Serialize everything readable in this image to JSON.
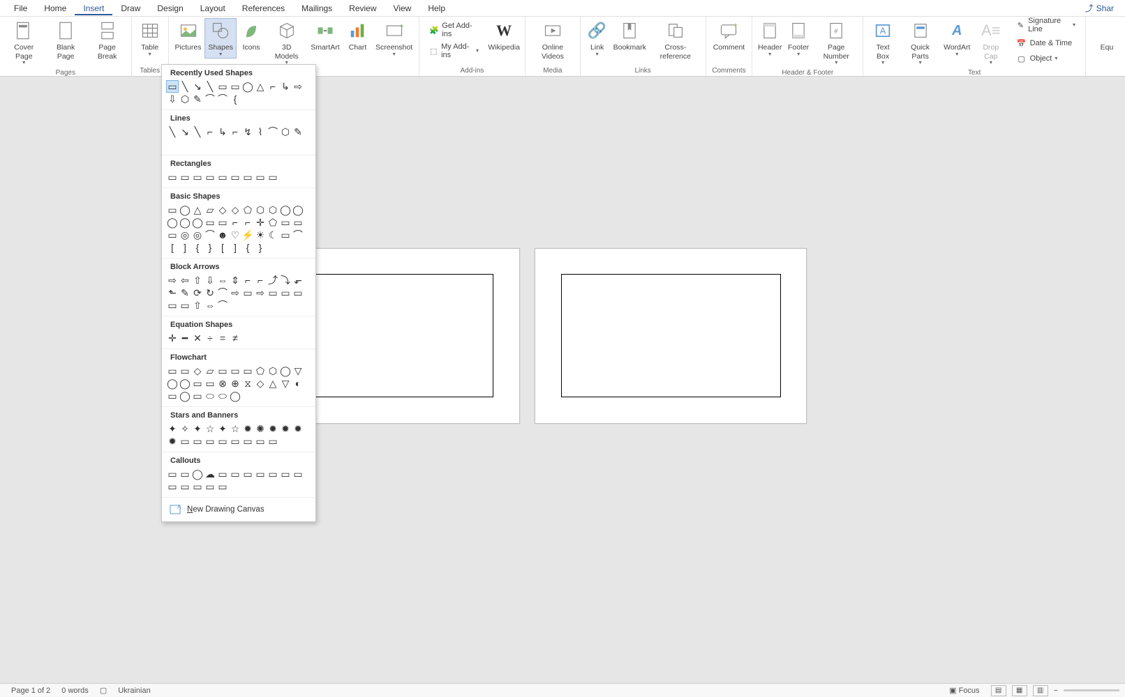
{
  "menu": {
    "tabs": [
      "File",
      "Home",
      "Insert",
      "Draw",
      "Design",
      "Layout",
      "References",
      "Mailings",
      "Review",
      "View",
      "Help"
    ],
    "active": "Insert",
    "share": "Shar"
  },
  "ribbon": {
    "groups": {
      "pages": {
        "label": "Pages",
        "items": [
          "Cover Page",
          "Blank Page",
          "Page Break"
        ]
      },
      "tables": {
        "label": "Tables",
        "items": [
          "Table"
        ]
      },
      "illustrations": {
        "label": "",
        "items": [
          "Pictures",
          "Shapes",
          "Icons",
          "3D Models",
          "SmartArt",
          "Chart",
          "Screenshot"
        ]
      },
      "addins": {
        "label": "Add-ins",
        "get": "Get Add-ins",
        "my": "My Add-ins",
        "wikipedia": "Wikipedia"
      },
      "media": {
        "label": "Media",
        "items": [
          "Online Videos"
        ]
      },
      "links": {
        "label": "Links",
        "items": [
          "Link",
          "Bookmark",
          "Cross-reference"
        ]
      },
      "comments": {
        "label": "Comments",
        "items": [
          "Comment"
        ]
      },
      "headerfooter": {
        "label": "Header & Footer",
        "items": [
          "Header",
          "Footer",
          "Page Number"
        ]
      },
      "text": {
        "label": "Text",
        "items": [
          "Text Box",
          "Quick Parts",
          "WordArt",
          "Drop Cap"
        ],
        "side": [
          "Signature Line",
          "Date & Time",
          "Object"
        ]
      },
      "symbols": {
        "label": "",
        "items": [
          "Equ"
        ]
      }
    }
  },
  "shapes": {
    "sections": [
      {
        "title": "Recently Used Shapes",
        "count": 17
      },
      {
        "title": "Lines",
        "count": 12
      },
      {
        "title": "Rectangles",
        "count": 9
      },
      {
        "title": "Basic Shapes",
        "count": 42
      },
      {
        "title": "Block Arrows",
        "count": 27
      },
      {
        "title": "Equation Shapes",
        "count": 6
      },
      {
        "title": "Flowchart",
        "count": 28
      },
      {
        "title": "Stars and Banners",
        "count": 20
      },
      {
        "title": "Callouts",
        "count": 16
      }
    ],
    "footer": "New Drawing Canvas",
    "footer_key": "N"
  },
  "status": {
    "page": "Page 1 of 2",
    "words": "0 words",
    "lang": "Ukrainian",
    "focus": "Focus"
  }
}
